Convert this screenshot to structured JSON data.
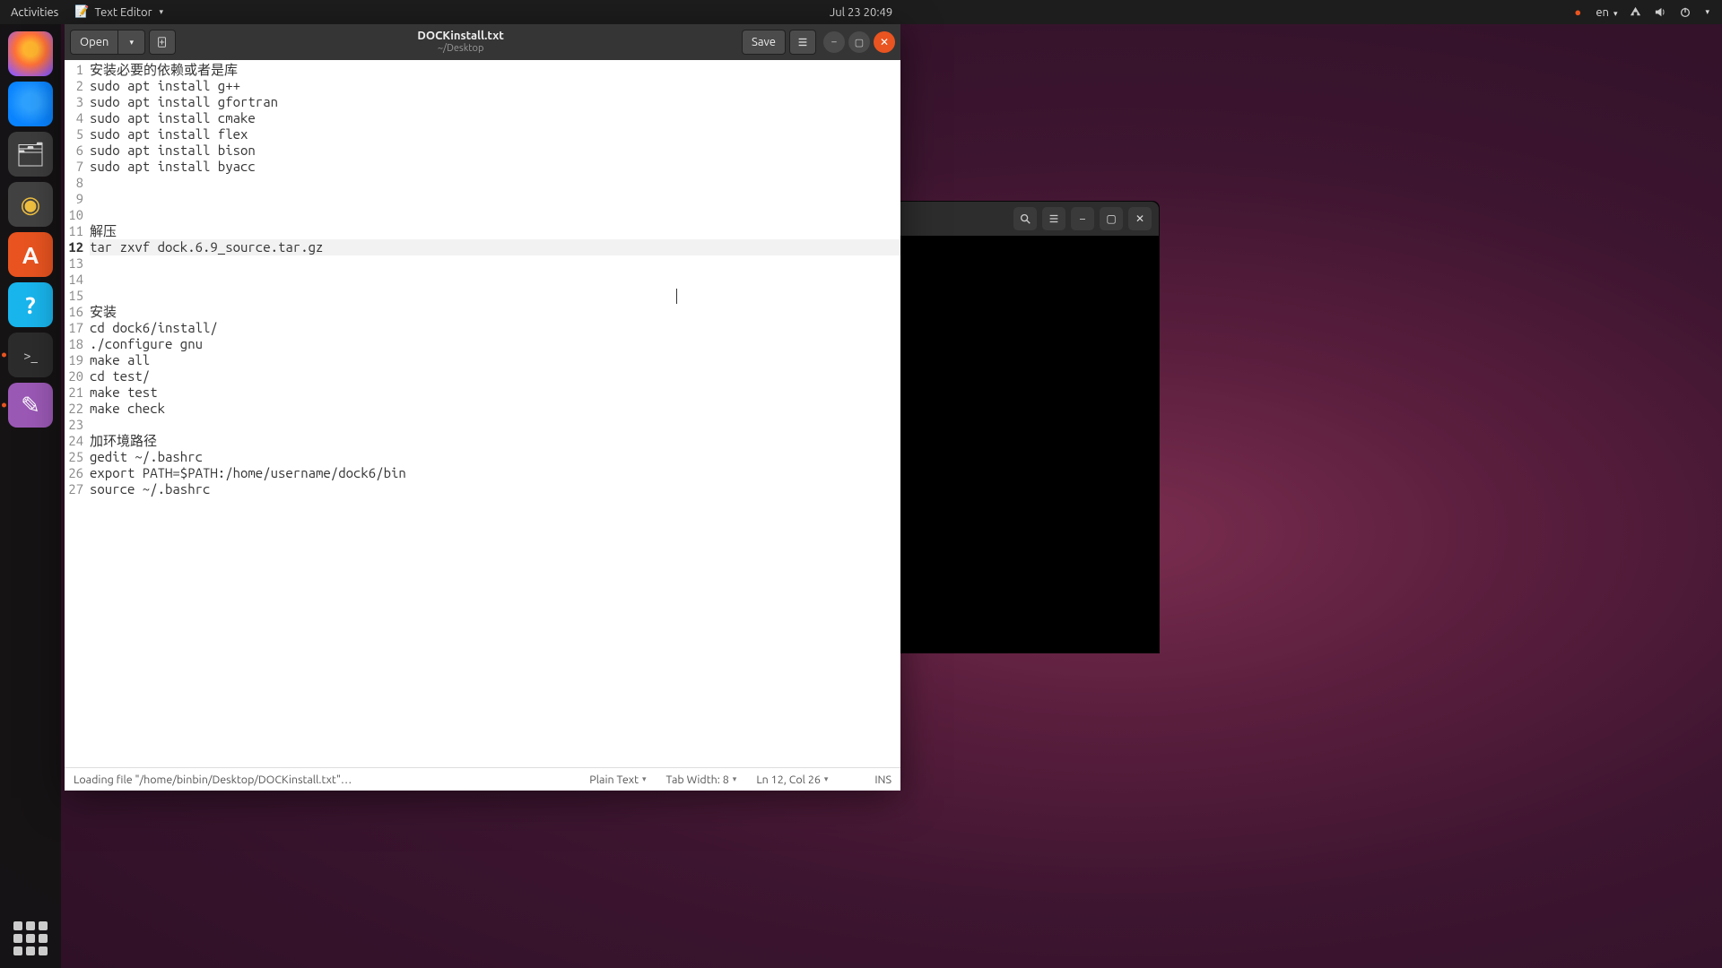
{
  "top_panel": {
    "activities": "Activities",
    "app_name": "Text Editor",
    "clock": "Jul 23  20:49",
    "lang": "en"
  },
  "dock": {
    "items": [
      {
        "name": "firefox",
        "glyph": ""
      },
      {
        "name": "thunderbird",
        "glyph": ""
      },
      {
        "name": "files",
        "glyph": "📁"
      },
      {
        "name": "rhythmbox",
        "glyph": "🎵"
      },
      {
        "name": "software",
        "glyph": "A"
      },
      {
        "name": "help",
        "glyph": "?"
      },
      {
        "name": "terminal",
        "glyph": ">_"
      },
      {
        "name": "text-editor",
        "glyph": "✎"
      }
    ]
  },
  "terminal": {
    "title": ": ~"
  },
  "gedit": {
    "header": {
      "open_label": "Open",
      "title": "DOCKinstall.txt",
      "subtitle": "~/Desktop",
      "save_label": "Save"
    },
    "lines": [
      "安装必要的依赖或者是库",
      "sudo apt install g++",
      "sudo apt install gfortran",
      "sudo apt install cmake",
      "sudo apt install flex",
      "sudo apt install bison",
      "sudo apt install byacc",
      "",
      "",
      "",
      "解压",
      "tar zxvf dock.6.9_source.tar.gz",
      "",
      "",
      "",
      "安装",
      "cd dock6/install/",
      "./configure gnu",
      "make all",
      "cd test/",
      "make test",
      "make check",
      "",
      "加环境路径",
      "gedit ~/.bashrc",
      "export PATH=$PATH:/home/username/dock6/bin",
      "source ~/.bashrc"
    ],
    "current_line_index": 11,
    "status": {
      "loading": "Loading file \"/home/binbin/Desktop/DOCKinstall.txt\"…",
      "syntax": "Plain Text",
      "tab_width": "Tab Width: 8",
      "cursor": "Ln 12, Col 26",
      "ins": "INS"
    }
  }
}
